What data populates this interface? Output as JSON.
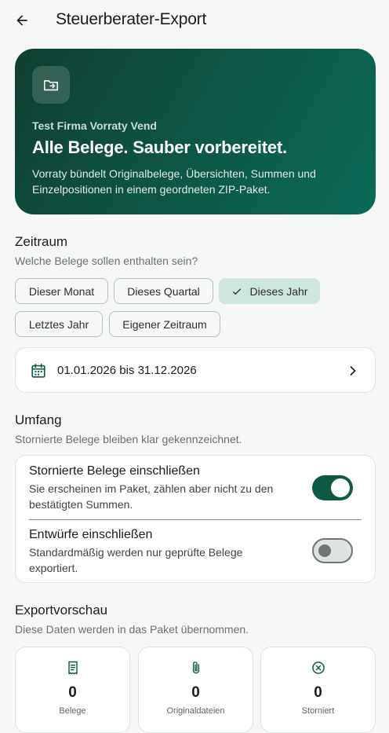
{
  "appbar": {
    "title": "Steuerberater-Export",
    "back_icon": "arrow-left-icon"
  },
  "hero": {
    "icon": "folder-export-icon",
    "company": "Test Firma Vorraty Vend",
    "headline": "Alle Belege. Sauber vorbereitet.",
    "description": "Vorraty bündelt Originalbelege, Übersichten, Summen und Einzelpositionen in einem geordneten ZIP-Paket."
  },
  "zeitraum": {
    "title": "Zeitraum",
    "subtitle": "Welche Belege sollen enthalten sein?",
    "chips": [
      {
        "label": "Dieser Monat",
        "selected": false
      },
      {
        "label": "Dieses Quartal",
        "selected": false
      },
      {
        "label": "Dieses Jahr",
        "selected": true
      },
      {
        "label": "Letztes Jahr",
        "selected": false
      },
      {
        "label": "Eigener Zeitraum",
        "selected": false
      }
    ],
    "date_range": "01.01.2026 bis 31.12.2026"
  },
  "umfang": {
    "title": "Umfang",
    "subtitle": "Stornierte Belege bleiben klar gekennzeichnet.",
    "options": [
      {
        "title": "Stornierte Belege einschließen",
        "description": "Sie erscheinen im Paket, zählen aber nicht zu den bestätigten Summen.",
        "enabled": true
      },
      {
        "title": "Entwürfe einschließen",
        "description": "Standardmäßig werden nur geprüfte Belege exportiert.",
        "enabled": false
      }
    ]
  },
  "preview": {
    "title": "Exportvorschau",
    "subtitle": "Diese Daten werden in das Paket übernommen.",
    "stats": [
      {
        "icon": "receipt-icon",
        "value": "0",
        "label": "Belege"
      },
      {
        "icon": "paperclip-icon",
        "value": "0",
        "label": "Originaldateien"
      },
      {
        "icon": "cancel-circle-icon",
        "value": "0",
        "label": "Storniert"
      }
    ]
  },
  "colors": {
    "primary": "#0e5a44",
    "chip_selected": "#cfe6dc",
    "background": "#f6f8f6"
  }
}
